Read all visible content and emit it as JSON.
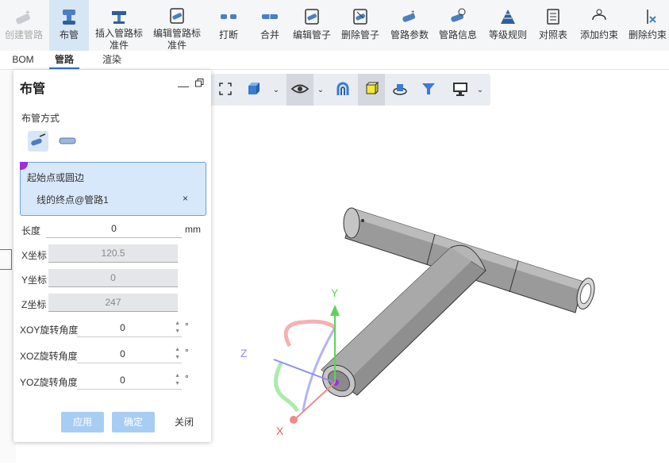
{
  "ribbon": {
    "items": [
      {
        "label": "创建管路",
        "icon": "create-pipe-icon",
        "state": "disabled"
      },
      {
        "label": "布管",
        "icon": "route-pipe-icon",
        "state": "active"
      },
      {
        "label": "插入管路标准件",
        "icon": "insert-standard-part-icon",
        "state": "normal"
      },
      {
        "label": "编辑管路标准件",
        "icon": "edit-standard-part-icon",
        "state": "normal"
      },
      {
        "label": "打断",
        "icon": "break-pipe-icon",
        "state": "normal"
      },
      {
        "label": "合并",
        "icon": "merge-pipe-icon",
        "state": "normal"
      },
      {
        "label": "编辑管子",
        "icon": "edit-pipe-icon",
        "state": "normal"
      },
      {
        "label": "删除管子",
        "icon": "delete-pipe-icon",
        "state": "normal"
      },
      {
        "label": "管路参数",
        "icon": "pipe-params-icon",
        "state": "normal"
      },
      {
        "label": "管路信息",
        "icon": "pipe-info-icon",
        "state": "normal"
      },
      {
        "label": "等级规则",
        "icon": "grade-rules-icon",
        "state": "normal"
      },
      {
        "label": "对照表",
        "icon": "lookup-table-icon",
        "state": "normal"
      },
      {
        "label": "添加约束",
        "icon": "add-constraint-icon",
        "state": "normal"
      },
      {
        "label": "删除约束",
        "icon": "delete-constraint-icon",
        "state": "normal"
      }
    ]
  },
  "tabs": [
    {
      "label": "BOM",
      "active": false
    },
    {
      "label": "管路",
      "active": true
    },
    {
      "label": "渲染",
      "active": false
    }
  ],
  "panel": {
    "title": "布管",
    "mode_label": "布管方式",
    "selection": {
      "header": "起始点或圆边",
      "item": "线的终点@管路1",
      "clear": "×"
    },
    "length": {
      "label": "长度",
      "value": "0",
      "unit": "mm"
    },
    "x": {
      "label": "X坐标",
      "value": "120.5"
    },
    "y": {
      "label": "Y坐标",
      "value": "0"
    },
    "z": {
      "label": "Z坐标",
      "value": "247"
    },
    "xoy": {
      "label": "XOY旋转角度",
      "value": "0",
      "unit": "°"
    },
    "xoz": {
      "label": "XOZ旋转角度",
      "value": "0",
      "unit": "°"
    },
    "yoz": {
      "label": "YOZ旋转角度",
      "value": "0",
      "unit": "°"
    },
    "buttons": {
      "apply": "应用",
      "ok": "确定",
      "close": "关闭"
    }
  },
  "viewport": {
    "axes": {
      "x": "X",
      "y": "Y",
      "z": "Z"
    },
    "colors": {
      "x_axis": "#f08a8a",
      "y_axis": "#5fd05f",
      "z_axis": "#8e8ef2",
      "pipe": "#9a9a9a",
      "endpoint": "#9b30e0"
    }
  }
}
